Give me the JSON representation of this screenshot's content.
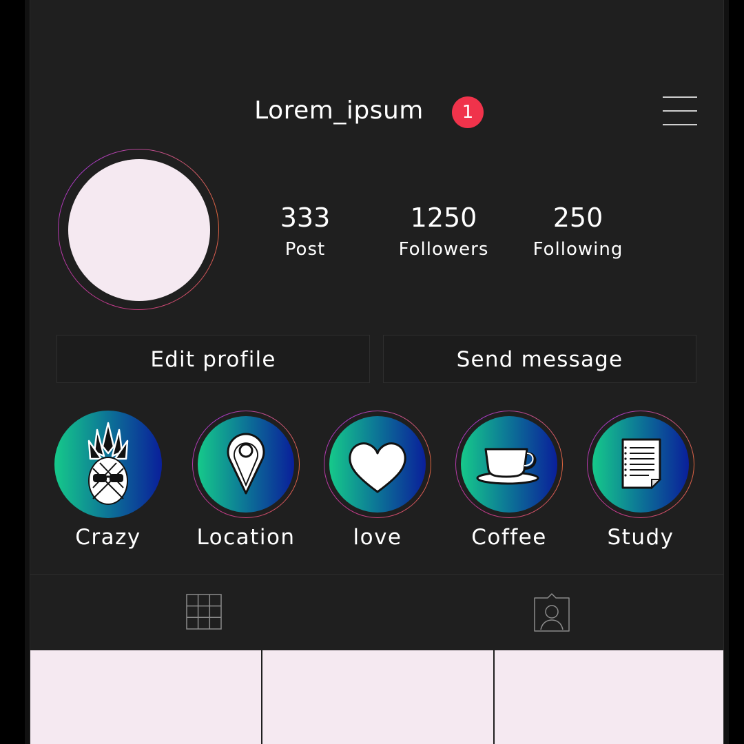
{
  "header": {
    "username": "Lorem_ipsum",
    "notification_count": "1"
  },
  "stats": [
    {
      "value": "333",
      "label": "Post"
    },
    {
      "value": "1250",
      "label": "Followers"
    },
    {
      "value": "250",
      "label": "Following"
    }
  ],
  "actions": {
    "edit_label": "Edit profile",
    "message_label": "Send message"
  },
  "highlights": [
    {
      "label": "Crazy",
      "icon": "pineapple-icon"
    },
    {
      "label": "Location",
      "icon": "location-pin-icon"
    },
    {
      "label": "love",
      "icon": "heart-icon"
    },
    {
      "label": "Coffee",
      "icon": "coffee-cup-icon"
    },
    {
      "label": "Study",
      "icon": "document-icon"
    }
  ],
  "tabs": [
    {
      "icon": "grid-icon"
    },
    {
      "icon": "tagged-user-icon"
    }
  ],
  "colors": {
    "background": "#1f1f1f",
    "badge": "#f0334b",
    "placeholder": "#f5e9f1",
    "highlight_gradient": [
      "#16c98a",
      "#0d7c96",
      "#0a1f9a"
    ],
    "story_ring": [
      "#c2398c",
      "#a83ac8",
      "#e0673d"
    ]
  }
}
